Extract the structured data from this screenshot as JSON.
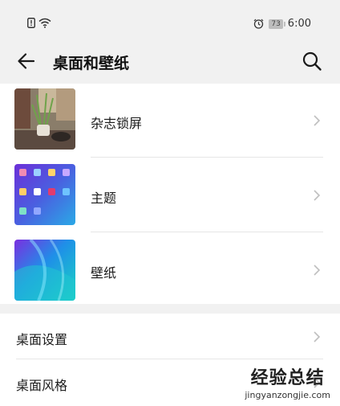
{
  "status_bar": {
    "time": "6:00",
    "battery": "73",
    "icons": [
      "sim-alert-icon",
      "wifi-icon",
      "alarm-icon",
      "battery-icon"
    ]
  },
  "header": {
    "title": "桌面和壁纸",
    "back_icon": "back-arrow-icon",
    "search_icon": "search-icon"
  },
  "section1": {
    "items": [
      {
        "label": "杂志锁屏",
        "thumb": "magazine-lockscreen-thumbnail"
      },
      {
        "label": "主题",
        "thumb": "theme-thumbnail"
      },
      {
        "label": "壁纸",
        "thumb": "wallpaper-thumbnail"
      }
    ]
  },
  "section2": {
    "items": [
      {
        "label": "桌面设置"
      },
      {
        "label": "桌面风格"
      }
    ]
  },
  "watermark": {
    "title": "经验总结",
    "url": "jingyanzongjie.com"
  },
  "colors": {
    "background": "#f1f1f1",
    "card": "#ffffff",
    "divider": "#e6e6e6",
    "chevron": "#bfbfbf"
  }
}
